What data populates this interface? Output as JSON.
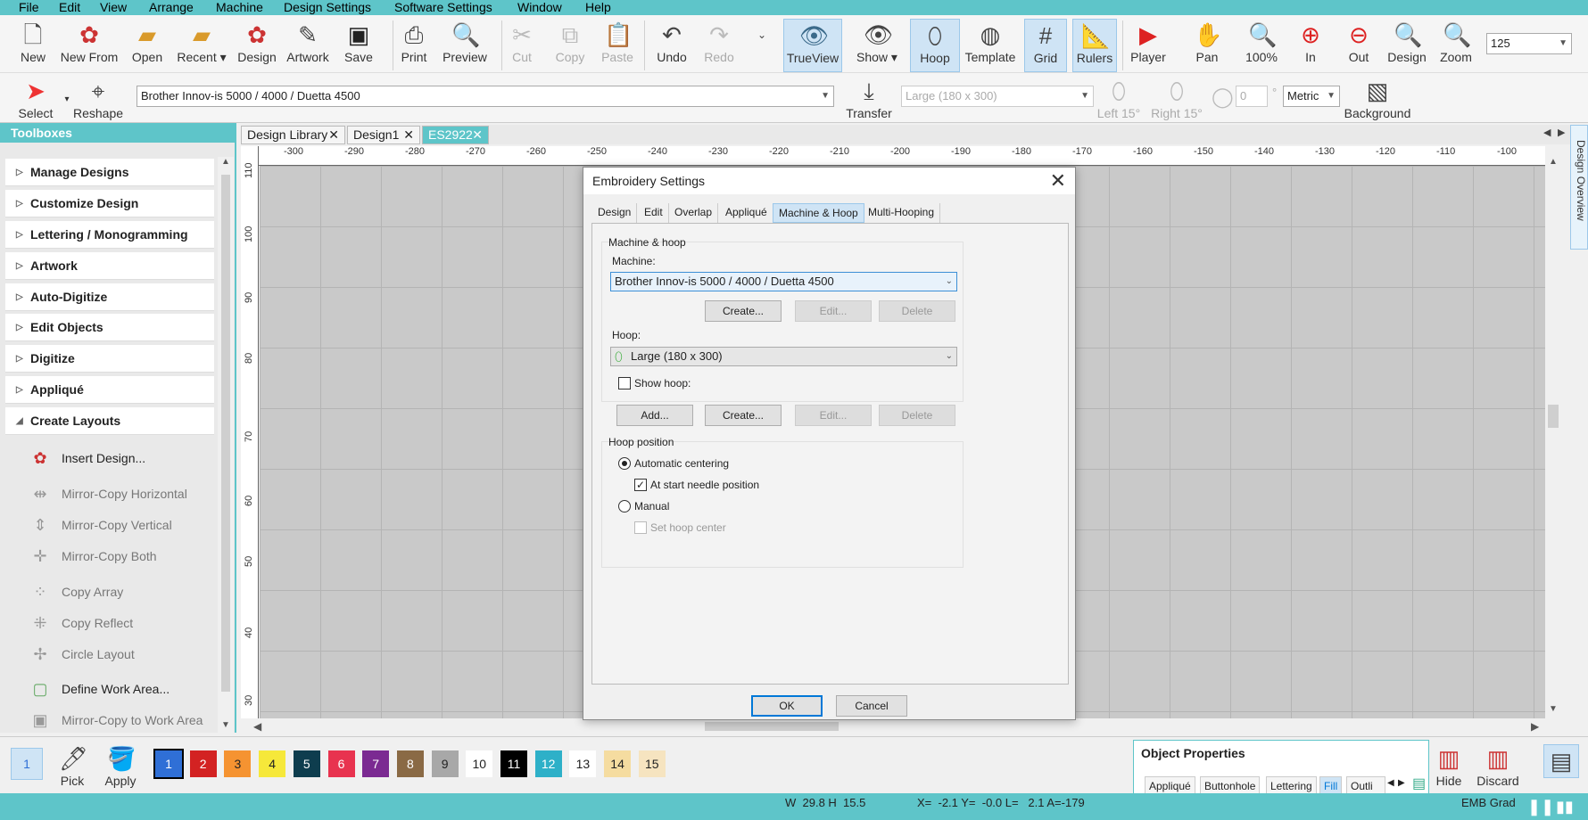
{
  "menu": [
    "File",
    "Edit",
    "View",
    "Arrange",
    "Machine",
    "Design Settings",
    "Software Settings",
    "Window",
    "Help"
  ],
  "toolbar": {
    "new": "New",
    "new_from": "New From",
    "open": "Open",
    "recent": "Recent",
    "design": "Design",
    "artwork": "Artwork",
    "save": "Save",
    "print": "Print",
    "preview": "Preview",
    "cut": "Cut",
    "copy": "Copy",
    "paste": "Paste",
    "undo": "Undo",
    "redo": "Redo",
    "trueview": "TrueView",
    "show": "Show",
    "hoop": "Hoop",
    "template": "Template",
    "grid": "Grid",
    "rulers": "Rulers",
    "player": "Player",
    "pan": "Pan",
    "zoom100": "100%",
    "zoom_in": "In",
    "zoom_out": "Out",
    "zoom_design": "Design",
    "zoom": "Zoom",
    "zoom_value": "125"
  },
  "toolbar2": {
    "select": "Select",
    "reshape": "Reshape",
    "machine_value": "Brother Innov-is 5000 / 4000 / Duetta 4500",
    "transfer": "Transfer",
    "hoop_value": "Large (180 x 300)",
    "left15": "Left 15°",
    "right15": "Right 15°",
    "rotate_value": "0",
    "deg": "°",
    "units": "Metric",
    "background": "Background"
  },
  "toolboxes": {
    "title": "Toolboxes",
    "categories": [
      "Manage Designs",
      "Customize Design",
      "Lettering / Monogramming",
      "Artwork",
      "Auto-Digitize",
      "Edit Objects",
      "Digitize",
      "Appliqué",
      "Create Layouts"
    ],
    "tools": [
      "Insert Design...",
      "Mirror-Copy Horizontal",
      "Mirror-Copy Vertical",
      "Mirror-Copy Both",
      "Copy Array",
      "Copy Reflect",
      "Circle Layout",
      "Define Work Area...",
      "Mirror-Copy to Work Area"
    ]
  },
  "doc_tabs": [
    "Design Library",
    "Design1",
    "ES2922"
  ],
  "ruler": {
    "top": [
      "-300",
      "-290",
      "-280",
      "-270",
      "-260",
      "-250",
      "-240",
      "-230",
      "-220",
      "-210",
      "-200",
      "-190",
      "-180",
      "-170",
      "-160",
      "-150",
      "-140",
      "-130",
      "-120",
      "-110",
      "-100"
    ],
    "left": [
      "110",
      "100",
      "90",
      "80",
      "70",
      "60",
      "50",
      "40",
      "30"
    ]
  },
  "side_tab": "Design Overview",
  "dialog": {
    "title": "Embroidery Settings",
    "tabs": [
      "Design",
      "Edit",
      "Overlap",
      "Appliqué",
      "Machine & Hoop",
      "Multi-Hooping"
    ],
    "group_machine_hoop": "Machine & hoop",
    "machine_label": "Machine:",
    "machine_value": "Brother Innov-is 5000 / 4000 / Duetta 4500",
    "create": "Create...",
    "edit": "Edit...",
    "delete": "Delete",
    "add": "Add...",
    "hoop_label": "Hoop:",
    "hoop_value": "Large (180 x 300)",
    "show_hoop": "Show hoop:",
    "group_hoop_position": "Hoop position",
    "auto_center": "Automatic centering",
    "at_start": "At start needle position",
    "manual": "Manual",
    "set_center": "Set hoop center",
    "ok": "OK",
    "cancel": "Cancel"
  },
  "bottom": {
    "current": "1",
    "pick": "Pick",
    "apply": "Apply",
    "swatches": [
      "1",
      "2",
      "3",
      "4",
      "5",
      "6",
      "7",
      "8",
      "9",
      "10",
      "11",
      "12",
      "13",
      "14",
      "15"
    ],
    "swatch_colors": [
      "#2f6fd6",
      "#d32222",
      "#f59331",
      "#f6e83a",
      "#0e3d4e",
      "#e8334f",
      "#7b2a92",
      "#8a6a45",
      "#a8a8a8",
      "#ffffff",
      "#000000",
      "#2eb0c8",
      "#ffffff",
      "#f5dca0",
      "#f6e4c0"
    ],
    "hide": "Hide",
    "discard": "Discard"
  },
  "object_properties": {
    "title": "Object Properties",
    "tabs": [
      "Appliqué",
      "Buttonhole",
      "Lettering",
      "Fill",
      "Outli"
    ]
  },
  "status": {
    "size": "W  29.8 H  15.5",
    "coords": "X=  -2.1 Y=  -0.0 L=   2.1 A=-179",
    "format": "EMB Grad"
  }
}
